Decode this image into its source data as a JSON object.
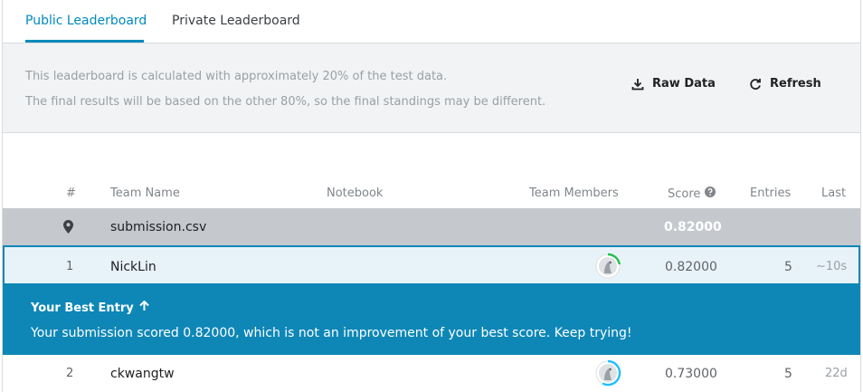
{
  "tabs": [
    {
      "label": "Public Leaderboard",
      "active": true
    },
    {
      "label": "Private Leaderboard",
      "active": false
    }
  ],
  "notice": {
    "line1": "This leaderboard is calculated with approximately 20% of the test data.",
    "line2": "The final results will be based on the other 80%, so the final standings may be different."
  },
  "actions": {
    "raw_data": "Raw Data",
    "refresh": "Refresh",
    "raw_data_icon": "download-icon",
    "refresh_icon": "refresh-icon"
  },
  "table": {
    "headers": {
      "rank": "#",
      "team_name": "Team Name",
      "notebook": "Notebook",
      "team_members": "Team Members",
      "score": "Score",
      "entries": "Entries",
      "last": "Last"
    },
    "submission": {
      "icon": "location-pin-icon",
      "name": "submission.csv",
      "score": "0.82000"
    },
    "rows": [
      {
        "rank": "1",
        "team": "NickLin",
        "score": "0.82000",
        "entries": "5",
        "last": "~10s"
      },
      {
        "rank": "2",
        "team": "ckwangtw",
        "score": "0.73000",
        "entries": "5",
        "last": "22d"
      }
    ]
  },
  "banner": {
    "title": "Your Best Entry",
    "message": "Your submission scored 0.82000, which is not an improvement of your best score. Keep trying!"
  },
  "colors": {
    "accent": "#008abc",
    "banner": "#0e87b7",
    "submission_row": "#c5c9cd",
    "highlight_row": "#e8f3f9"
  }
}
